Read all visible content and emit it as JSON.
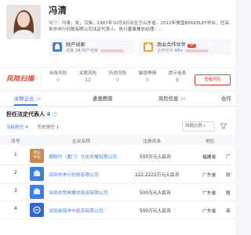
{
  "profile": {
    "name": "冯清",
    "intro_label": "简介：",
    "intro_text": "冯清，女，汉族，1987年10月9日出生于山东省。2012年美国BERKELEY毕业，任深圳市丰行创投有限公司法定代表人、执行董事兼总经理。",
    "more": "...",
    "risk_title": "财产线索",
    "risk_sub_label": "线索",
    "risk_sub_num": "24",
    "risk_sub_suffix": "财产线索",
    "ptn_title": "商业合作伙伴",
    "ptn_badge": "VIP",
    "ptn_sub": "合作伙伴",
    "ptn_num": "99+"
  },
  "scan": {
    "logo": "风险扫描",
    "items": [
      {
        "label": "自身风险",
        "value": "0",
        "color": "#999999"
      },
      {
        "label": "关联风险",
        "value": "11",
        "color": "#e8412e"
      },
      {
        "label": "历史风险",
        "value": "0",
        "color": "#999999"
      },
      {
        "label": "敏感舆情",
        "value": "0",
        "color": "#999999"
      },
      {
        "label": "提示信息",
        "value": "5",
        "color": "#e8412e"
      }
    ],
    "button": "查看风险"
  },
  "tabs": [
    {
      "label": "关联企业",
      "count": "20"
    },
    {
      "label": "查查图谱",
      "count": ""
    },
    {
      "label": "风险信息",
      "count": "16"
    },
    {
      "label": "合作",
      "count": ""
    }
  ],
  "section": {
    "title": "担任法定代表人",
    "title_count": "4",
    "sub_tabs": [
      {
        "label": "当前担任",
        "count": "4"
      },
      {
        "label": "历史担任",
        "count": "1"
      }
    ],
    "filter_label": "持股比例",
    "headers": [
      "序号",
      "企业名称",
      "注册资本",
      "地区"
    ],
    "rows": [
      {
        "idx": "1",
        "logo_text": "绍业\n文化",
        "logo_color": "#c98a4c",
        "company": "德阳代（厦门）文化传播有限公司",
        "capital": "500万元人民币",
        "region": "福建省",
        "extra": "厂"
      },
      {
        "idx": "2",
        "logo_text": "",
        "logo_color": "#3f7ee8",
        "company": "深圳市丰行创投有限公司",
        "capital": "222.2222万元人民币",
        "region": "广东省",
        "extra": "软"
      },
      {
        "idx": "3",
        "logo_text": "",
        "logo_color": "#3f7ee8",
        "company": "深圳市梵希餐饮投资有限公司",
        "capital": "500万元人民币",
        "region": "广东省",
        "extra": "租"
      },
      {
        "idx": "4",
        "logo_text": "",
        "logo_color": "#2e68d8",
        "company": "深圳前海丰中投资有限公司",
        "capital": "500万元人民币",
        "region": "广东省",
        "extra": "商"
      }
    ]
  },
  "colors": {
    "accent": "#3f7ee8",
    "danger": "#e8412e"
  }
}
